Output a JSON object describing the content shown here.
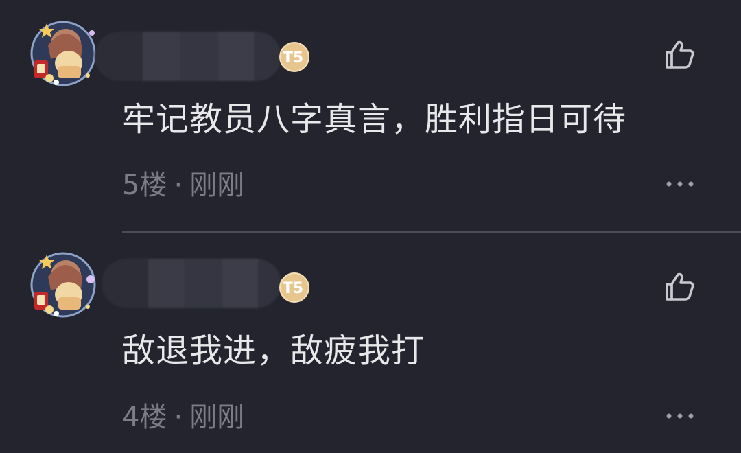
{
  "comments": [
    {
      "text": "牢记教员八字真言，胜利指日可待",
      "floor": "5楼",
      "separator": "·",
      "time": "刚刚",
      "level_badge": "T5"
    },
    {
      "text": "敌退我进，敌疲我打",
      "floor": "4楼",
      "separator": "·",
      "time": "刚刚",
      "level_badge": "T5"
    }
  ],
  "icons": {
    "like": "thumbs-up-icon",
    "more": "more-dots-icon",
    "avatar": "anime-avatar-icon",
    "badge": "level-badge-icon"
  },
  "colors": {
    "background": "#23242e",
    "comment_text": "#e8e8ea",
    "meta_text": "#7c7d86",
    "badge_gold": "#e7c58e",
    "divider": "#4a4b55"
  }
}
